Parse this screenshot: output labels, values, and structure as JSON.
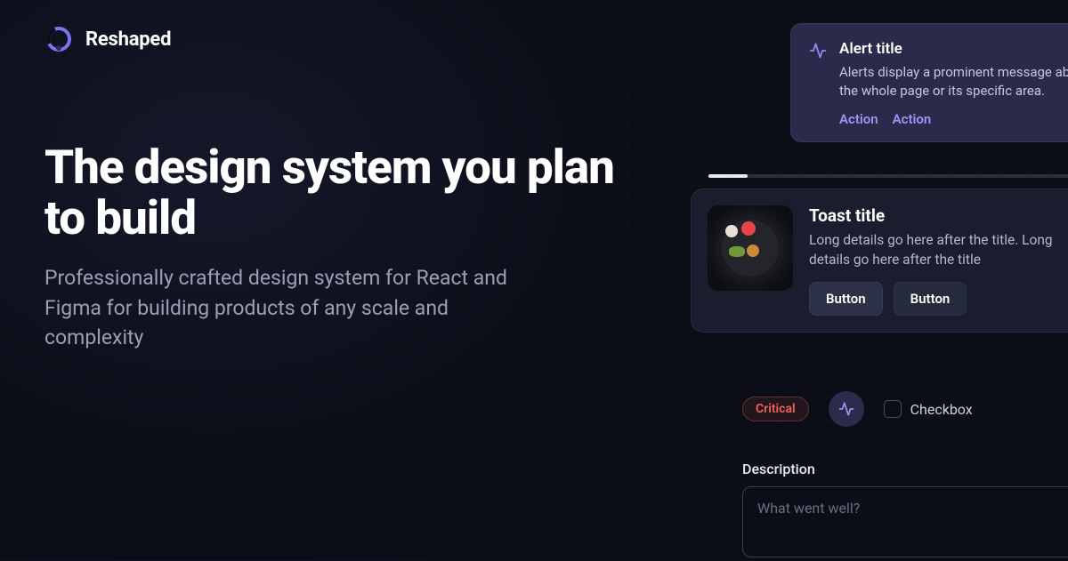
{
  "brand": {
    "name": "Reshaped"
  },
  "hero": {
    "title": "The design system you plan to build",
    "subtitle": "Professionally crafted design system for React and Figma for building products of any scale and complexity"
  },
  "alert": {
    "title": "Alert title",
    "description": "Alerts display a prominent message about the whole page or its specific area.",
    "actions": [
      "Action",
      "Action"
    ]
  },
  "toast": {
    "title": "Toast title",
    "description": "Long details go here after the title. Long details go here after the title",
    "buttons": [
      "Button",
      "Button"
    ]
  },
  "badge": {
    "label": "Critical"
  },
  "checkbox": {
    "label": "Checkbox"
  },
  "field": {
    "label": "Description",
    "placeholder": "What went well?"
  }
}
